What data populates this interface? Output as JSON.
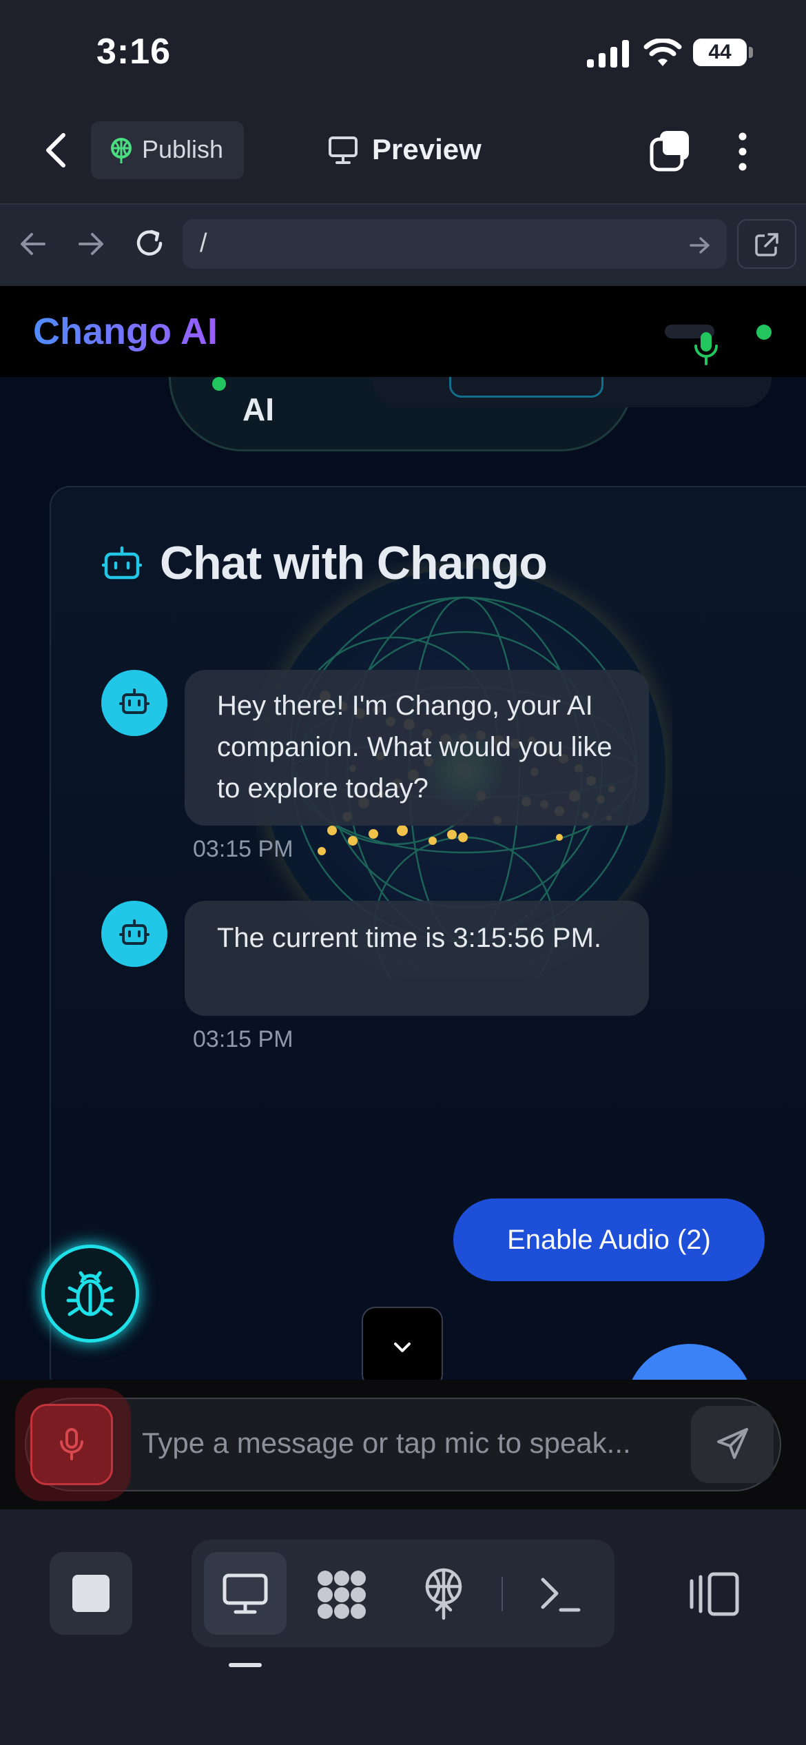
{
  "status_bar": {
    "time": "3:16",
    "battery": "44"
  },
  "toolbar": {
    "publish_label": "Publish",
    "preview_label": "Preview"
  },
  "address_bar": {
    "url": "/"
  },
  "app_header": {
    "brand": "Chango AI"
  },
  "background_fragment": {
    "label": "AI"
  },
  "chat": {
    "title": "Chat with Chango",
    "messages": [
      {
        "sender": "assistant",
        "text": "Hey there! I'm Chango, your AI companion. What would you like to explore today?",
        "time": "03:15 PM"
      },
      {
        "sender": "assistant",
        "text": "The current time is 3:15:56 PM.",
        "time": "03:15 PM"
      }
    ],
    "enable_audio_label": "Enable Audio (2)"
  },
  "input": {
    "placeholder": "Type a message or tap mic to speak..."
  },
  "colors": {
    "accent_cyan": "#22c6e6",
    "brand_blue": "#4f8cff",
    "brand_purple": "#9b5cff",
    "enable_audio_bg": "#1d4fd8",
    "mic_red": "#c2333b",
    "status_green": "#22c55e"
  }
}
